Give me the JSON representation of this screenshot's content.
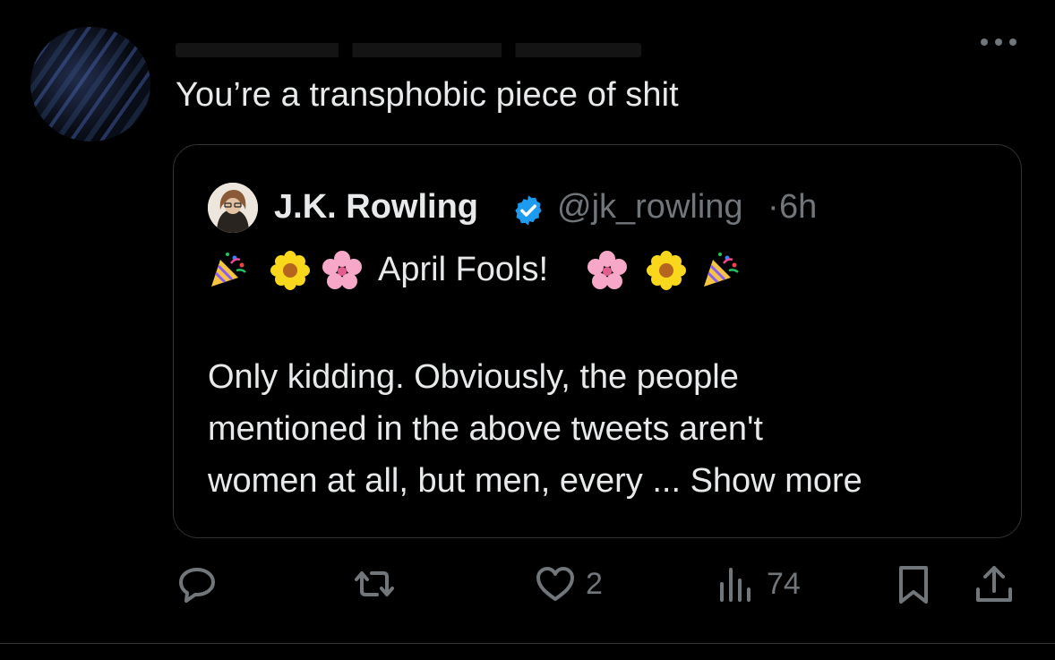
{
  "reply": {
    "text": "You’re a transphobic piece of shit"
  },
  "quoted_tweet": {
    "author_name": "J.K. Rowling",
    "handle": "@jk_rowling",
    "separator": "·",
    "time": "6h",
    "emoji_line_text": "April Fools!",
    "body_lines": [
      "Only kidding. Obviously, the people",
      "mentioned in the above tweets aren't",
      "women at all, but men, every ..."
    ],
    "show_more": "Show more"
  },
  "actions": {
    "likes": "2",
    "views": "74"
  },
  "colors": {
    "background": "#000000",
    "text": "#e7e9ea",
    "muted": "#71767b",
    "border": "#2f3336",
    "verified": "#1d9bf0"
  }
}
